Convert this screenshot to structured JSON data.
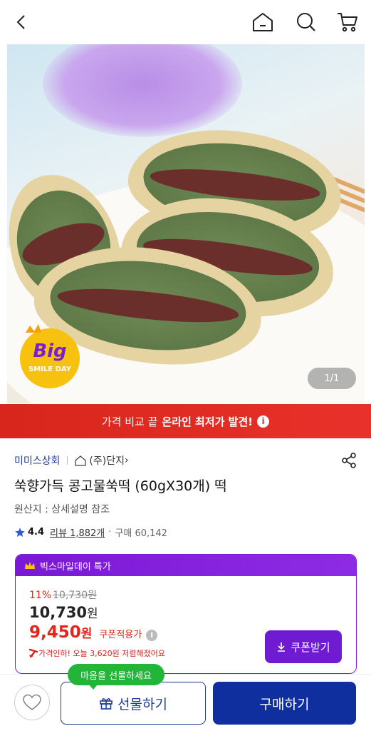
{
  "header": {
    "back_icon": "chevron-left-icon",
    "home_icon": "home-icon",
    "search_icon": "search-icon",
    "cart_icon": "cart-icon"
  },
  "hero": {
    "badge_top": "Big",
    "badge_bottom": "SMILE DAY",
    "counter": "1/1"
  },
  "banner": {
    "text": "가격 비교 끝",
    "strong": "온라인 최저가 발견!",
    "info_glyph": "i",
    "color": "#e3302a"
  },
  "product": {
    "seller": "미미스상회",
    "shop": "(주)단지",
    "shop_chevron": "›",
    "title": "쑥향가득 콩고물쑥떡 (60gX30개) 떡",
    "origin": "원산지 : 상세설명 참조",
    "rating": "4.4",
    "reviews": "리뷰 1,882개",
    "purchases": "구매 60,142"
  },
  "deal": {
    "header": "빅스마일데이 특가",
    "discount": "11%",
    "original_price": "10,730원",
    "price": "10,730",
    "price_unit": "원",
    "coupon_price": "9,450",
    "coupon_unit": "원",
    "coupon_label": "쿠폰적용가",
    "info_glyph": "i",
    "price_drop": "가격인하! 오늘 3,620원 저렴해졌어요",
    "coupon_button": "쿠폰받기",
    "accent": "#7b1fd6",
    "sale_color": "#e5241b"
  },
  "bottom": {
    "bubble": "마음을 선물하세요",
    "gift": "선물하기",
    "buy": "구매하기",
    "buy_color": "#0f2f9e"
  }
}
